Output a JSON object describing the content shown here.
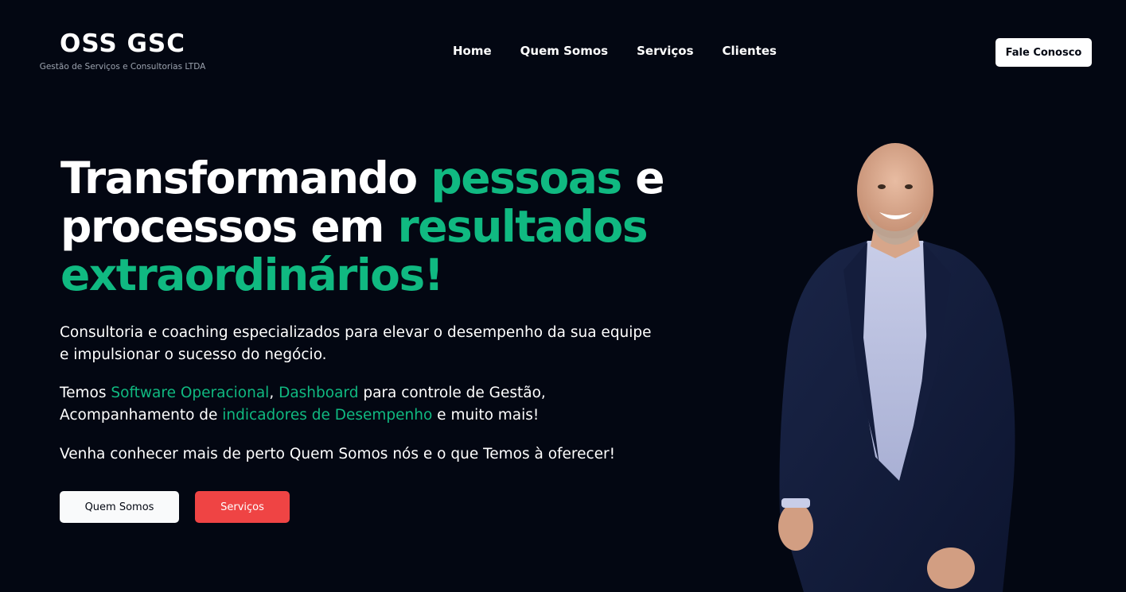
{
  "brand": {
    "title": "OSS GSC",
    "subtitle": "Gestão de Serviços e Consultorias LTDA"
  },
  "nav": {
    "items": [
      "Home",
      "Quem Somos",
      "Serviços",
      "Clientes"
    ]
  },
  "header": {
    "cta_label": "Fale Conosco"
  },
  "hero": {
    "title": {
      "part1": "Transformando ",
      "accent1": "pessoas",
      "part2": " e processos em ",
      "accent2": "resultados extraordinários!"
    },
    "paragraph1": "Consultoria e coaching especializados para elevar o desempenho da sua equipe e impulsionar o sucesso do negócio.",
    "paragraph2": {
      "t1": "Temos ",
      "h1": "Software Operacional",
      "t2": ", ",
      "h2": "Dashboard",
      "t3": " para controle de Gestão, Acompanhamento de ",
      "h3": "indicadores de Desempenho",
      "t4": " e muito mais!"
    },
    "paragraph3": "Venha conhecer mais de perto Quem Somos nós e o que Temos à oferecer!",
    "button_about": "Quem Somos",
    "button_services": "Serviços"
  },
  "colors": {
    "background": "#030712",
    "accent": "#10b981",
    "danger": "#ef4444",
    "text": "#ffffff"
  }
}
